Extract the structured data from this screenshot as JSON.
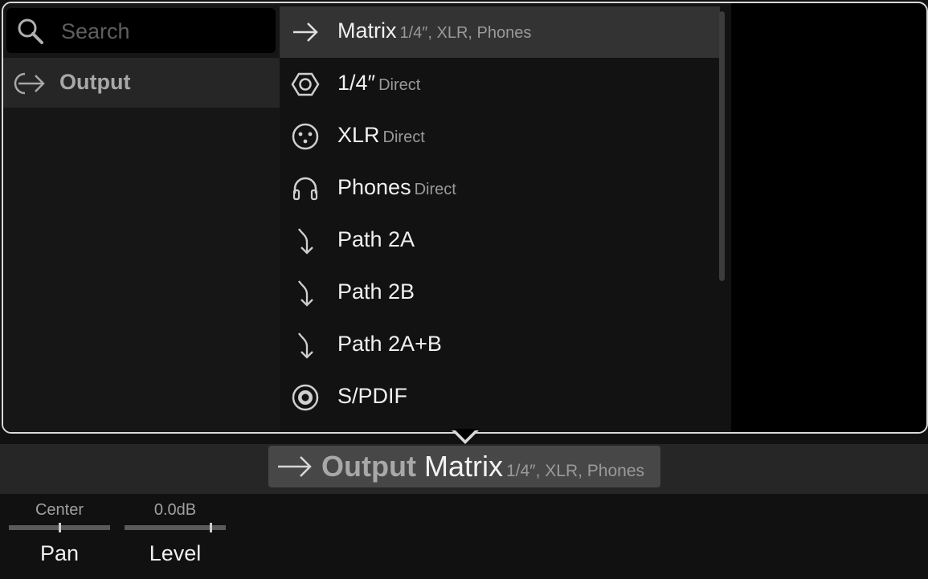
{
  "search": {
    "placeholder": "Search"
  },
  "category": {
    "label": "Output",
    "icon": "output-arrow-icon"
  },
  "items": [
    {
      "label": "Matrix",
      "sub": "1/4″, XLR, Phones",
      "icon": "arrow-right-icon",
      "selected": true
    },
    {
      "label": "1/4″",
      "sub": "Direct",
      "icon": "hexagon-jack-icon"
    },
    {
      "label": "XLR",
      "sub": "Direct",
      "icon": "xlr-icon"
    },
    {
      "label": "Phones",
      "sub": "Direct",
      "icon": "headphones-icon"
    },
    {
      "label": "Path 2A",
      "sub": "",
      "icon": "path-arrow-icon"
    },
    {
      "label": "Path 2B",
      "sub": "",
      "icon": "path-arrow-icon"
    },
    {
      "label": "Path 2A+B",
      "sub": "",
      "icon": "path-arrow-icon"
    },
    {
      "label": "S/PDIF",
      "sub": "",
      "icon": "spdif-icon"
    }
  ],
  "block": {
    "category": "Output",
    "name": "Matrix",
    "sub": "1/4″, XLR, Phones"
  },
  "params": [
    {
      "name": "Pan",
      "value": "Center",
      "position": 0.5
    },
    {
      "name": "Level",
      "value": "0.0dB",
      "position": 0.85
    }
  ],
  "colors": {
    "background": "#111111",
    "selected": "#333333",
    "border": "#d9d9d9"
  }
}
